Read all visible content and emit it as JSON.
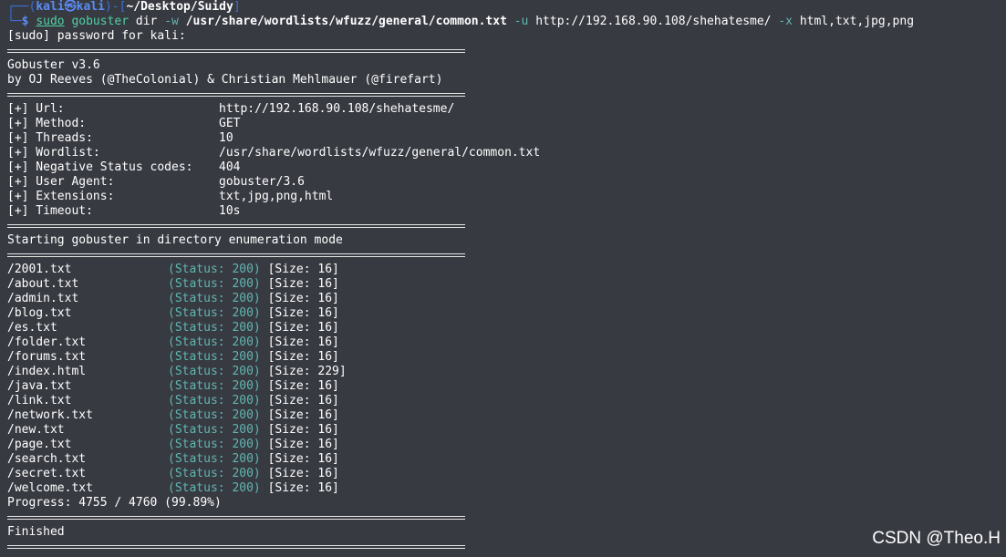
{
  "prompt": {
    "corner_top": "┌──(",
    "user": "kali",
    "at_symbol": "㉿",
    "host": "kali",
    "dir_open": ")-[",
    "dir": "~/Desktop/Suidy",
    "dir_close": "]",
    "corner_bottom": "└─",
    "dollar": "$ "
  },
  "command": {
    "sudo": "sudo",
    "tool": "gobuster",
    "subcommand": " dir ",
    "w_flag": "-w",
    "wordlist": "/usr/share/wordlists/wfuzz/general/common.txt",
    "u_flag": "-u",
    "url": "http://192.168.90.108/shehatesme/",
    "x_flag": "-x",
    "extensions": "html,txt,jpg,png"
  },
  "sudo_prompt": "[sudo] password for kali:",
  "banner": {
    "version": "Gobuster v3.6",
    "authors": "by OJ Reeves (@TheColonial) & Christian Mehlmauer (@firefart)"
  },
  "config": [
    {
      "key": "[+] Url:",
      "value": "http://192.168.90.108/shehatesme/"
    },
    {
      "key": "[+] Method:",
      "value": "GET"
    },
    {
      "key": "[+] Threads:",
      "value": "10"
    },
    {
      "key": "[+] Wordlist:",
      "value": "/usr/share/wordlists/wfuzz/general/common.txt"
    },
    {
      "key": "[+] Negative Status codes:",
      "value": "404"
    },
    {
      "key": "[+] User Agent:",
      "value": "gobuster/3.6"
    },
    {
      "key": "[+] Extensions:",
      "value": "txt,jpg,png,html"
    },
    {
      "key": "[+] Timeout:",
      "value": "10s"
    }
  ],
  "mode_message": "Starting gobuster in directory enumeration mode",
  "results": [
    {
      "path": "/2001.txt",
      "status": "(Status: 200)",
      "size": "[Size: 16]"
    },
    {
      "path": "/about.txt",
      "status": "(Status: 200)",
      "size": "[Size: 16]"
    },
    {
      "path": "/admin.txt",
      "status": "(Status: 200)",
      "size": "[Size: 16]"
    },
    {
      "path": "/blog.txt",
      "status": "(Status: 200)",
      "size": "[Size: 16]"
    },
    {
      "path": "/es.txt",
      "status": "(Status: 200)",
      "size": "[Size: 16]"
    },
    {
      "path": "/folder.txt",
      "status": "(Status: 200)",
      "size": "[Size: 16]"
    },
    {
      "path": "/forums.txt",
      "status": "(Status: 200)",
      "size": "[Size: 16]"
    },
    {
      "path": "/index.html",
      "status": "(Status: 200)",
      "size": "[Size: 229]"
    },
    {
      "path": "/java.txt",
      "status": "(Status: 200)",
      "size": "[Size: 16]"
    },
    {
      "path": "/link.txt",
      "status": "(Status: 200)",
      "size": "[Size: 16]"
    },
    {
      "path": "/network.txt",
      "status": "(Status: 200)",
      "size": "[Size: 16]"
    },
    {
      "path": "/new.txt",
      "status": "(Status: 200)",
      "size": "[Size: 16]"
    },
    {
      "path": "/page.txt",
      "status": "(Status: 200)",
      "size": "[Size: 16]"
    },
    {
      "path": "/search.txt",
      "status": "(Status: 200)",
      "size": "[Size: 16]"
    },
    {
      "path": "/secret.txt",
      "status": "(Status: 200)",
      "size": "[Size: 16]"
    },
    {
      "path": "/welcome.txt",
      "status": "(Status: 200)",
      "size": "[Size: 16]"
    }
  ],
  "progress": "Progress: 4755 / 4760 (99.89%)",
  "finished": "Finished",
  "watermark": "CSDN @Theo.H",
  "colors": {
    "background": "#383a42",
    "prompt_blue": "#3a6fd8",
    "status_teal": "#5fb7b0",
    "command_green": "#4fd0a3"
  }
}
